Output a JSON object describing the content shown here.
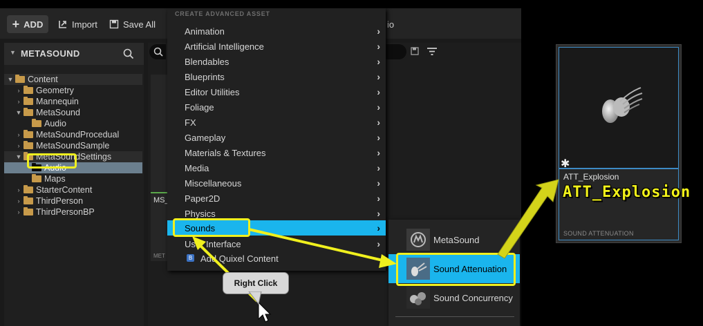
{
  "toolbar": {
    "add_label": "ADD",
    "import_label": "Import",
    "save_all_label": "Save All",
    "behind_text": "io"
  },
  "sidebar": {
    "title": "METASOUND",
    "tree": [
      {
        "label": "Content",
        "expanded": true
      },
      {
        "label": "Geometry"
      },
      {
        "label": "Mannequin"
      },
      {
        "label": "MetaSound",
        "expanded": true
      },
      {
        "label": "Audio"
      },
      {
        "label": "MetaSoundProcedual"
      },
      {
        "label": "MetaSoundSample"
      },
      {
        "label": "MetaSoundSettings",
        "expanded": true
      },
      {
        "label": "Audio",
        "selected": true
      },
      {
        "label": "Maps"
      },
      {
        "label": "StarterContent"
      },
      {
        "label": "ThirdPerson"
      },
      {
        "label": "ThirdPersonBP"
      }
    ]
  },
  "content": {
    "card_label_fragment": "MS_",
    "card_type_fragment": "MET"
  },
  "context_menu": {
    "header": "CREATE ADVANCED ASSET",
    "items": [
      "Animation",
      "Artificial Intelligence",
      "Blendables",
      "Blueprints",
      "Editor Utilities",
      "Foliage",
      "FX",
      "Gameplay",
      "Materials & Textures",
      "Media",
      "Miscellaneous",
      "Paper2D",
      "Physics",
      "Sounds",
      "User Interface"
    ],
    "highlighted": "Sounds",
    "extra_item": "Add Quixel Content"
  },
  "submenu": {
    "items": [
      "MetaSound",
      "Sound Attenuation",
      "Sound Concurrency"
    ],
    "highlighted": "Sound Attenuation"
  },
  "asset_card": {
    "name": "ATT_Explosion",
    "type": "SOUND ATTENUATION",
    "callout": "ATT_Explosion"
  },
  "annotation": {
    "bubble_text": "Right Click",
    "color": "#f0f01e"
  },
  "colors": {
    "highlight": "#1ab5ed",
    "selection": "#6b7f8e",
    "folder": "#c79a4a"
  }
}
